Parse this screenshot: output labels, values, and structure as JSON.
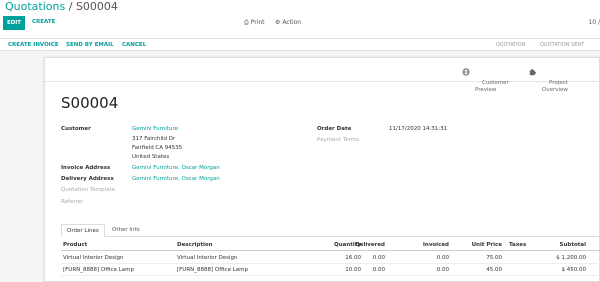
{
  "breadcrumb": {
    "parent": "Quotations",
    "separator": "/",
    "current": "S00004"
  },
  "toolbar": {
    "edit_label": "EDIT",
    "create_label": "CREATE",
    "print_label": "Print",
    "action_label": "Action",
    "pager": "10 /"
  },
  "statusbar": {
    "buttons": [
      "CREATE INVOICE",
      "SEND BY EMAIL",
      "CANCEL"
    ],
    "stages": [
      "QUOTATION",
      "QUOTATION SENT"
    ]
  },
  "smart_buttons": {
    "customer_preview": "Customer\nPreview",
    "project_overview": "Project\nOverview"
  },
  "record": {
    "name": "S00004",
    "customer_label": "Customer",
    "customer_name": "Gemini Furniture",
    "customer_addr1": "317 Fairchild Dr",
    "customer_addr2": "Fairfield CA 94535",
    "customer_addr3": "United States",
    "invoice_label": "Invoice Address",
    "invoice_value": "Gemini Furniture, Oscar Morgan",
    "delivery_label": "Delivery Address",
    "delivery_value": "Gemini Furniture, Oscar Morgan",
    "template_label": "Quotation Template",
    "referrer_label": "Referrer",
    "order_date_label": "Order Date",
    "order_date_value": "11/17/2020 14:31:31",
    "payment_terms_label": "Payment Terms"
  },
  "tabs": [
    "Order Lines",
    "Other Info"
  ],
  "table": {
    "headers": [
      "Product",
      "Description",
      "Quantity",
      "Delivered",
      "Invoiced",
      "Unit Price",
      "Taxes",
      "Subtotal"
    ],
    "rows": [
      [
        "Virtual Interior Design",
        "Virtual Interior Design",
        "16.00",
        "0.00",
        "0.00",
        "75.00",
        "",
        "$ 1,200.00"
      ],
      [
        "[FURN_8888] Office Lamp",
        "[FURN_8888] Office Lamp",
        "10.00",
        "0.00",
        "0.00",
        "45.00",
        "",
        "$ 450.00"
      ]
    ]
  },
  "colors": {
    "accent": "#00a09d"
  }
}
